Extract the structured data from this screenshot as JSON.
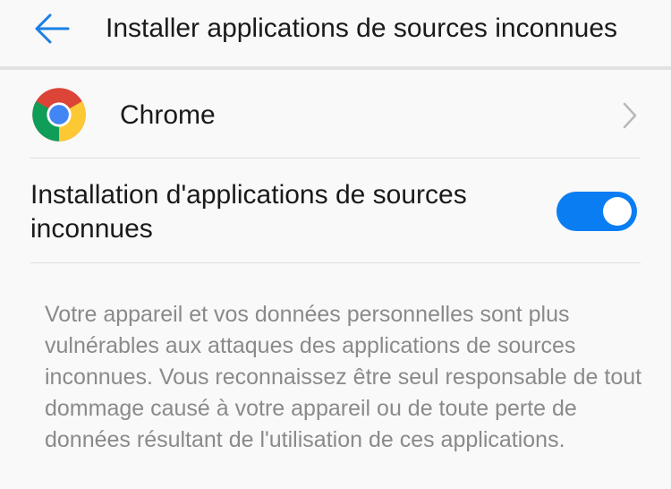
{
  "header": {
    "title": "Installer applications de sources inconnues",
    "back_icon": "arrow-left-icon",
    "accent_color": "#1a7fe6"
  },
  "app": {
    "name": "Chrome",
    "icon": "chrome-icon",
    "chevron_icon": "chevron-right-icon"
  },
  "setting": {
    "label": "Installation d'applications de sources inconnues",
    "enabled": true,
    "switch_color": "#0a7df2"
  },
  "warning": {
    "text": "Votre appareil et vos données personnelles sont plus vulnérables aux attaques des applications de sources inconnues. Vous reconnaissez être seul responsable de tout dommage causé à votre appareil ou de toute perte de données résultant de l'utilisation de ces applications."
  }
}
